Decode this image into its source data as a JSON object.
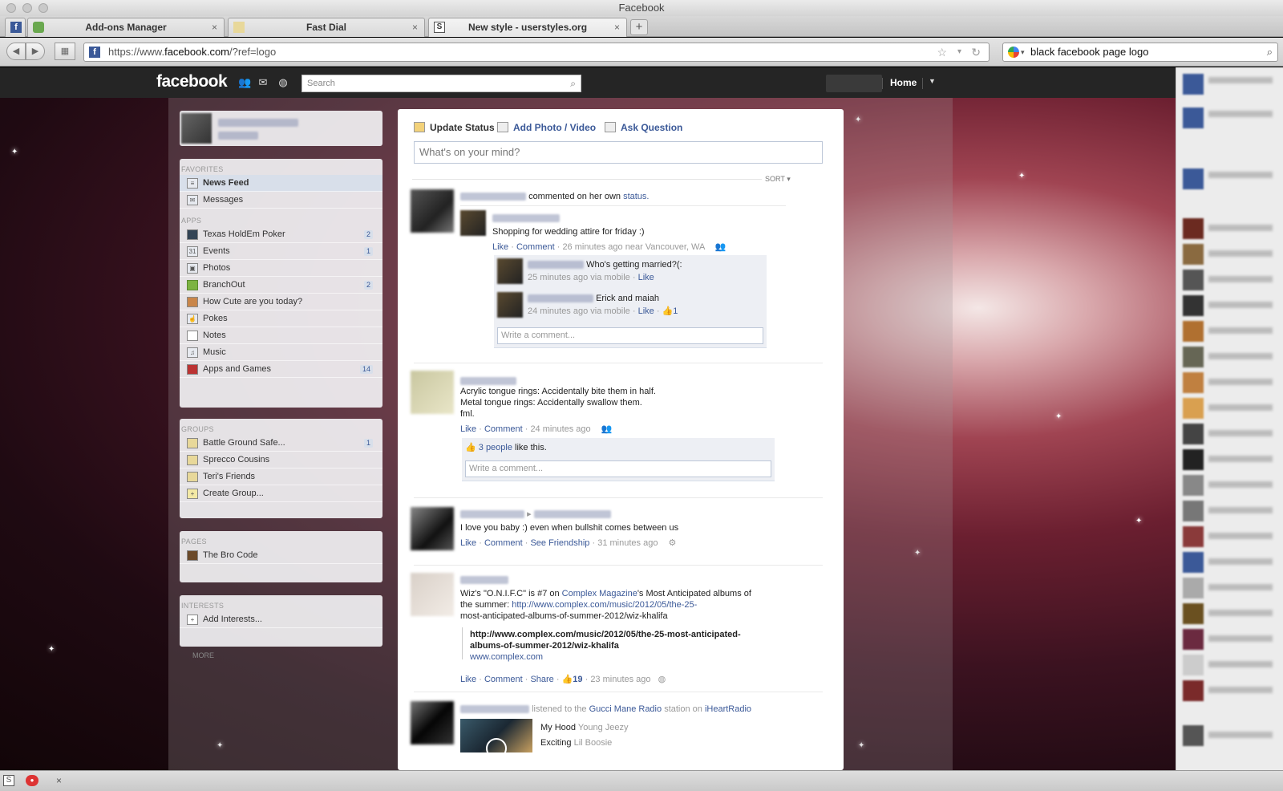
{
  "window": {
    "title": "Facebook"
  },
  "tabs": [
    {
      "label": "Add-ons Manager"
    },
    {
      "label": "Fast Dial"
    },
    {
      "label": "New style - userstyles.org"
    }
  ],
  "browser": {
    "url_scheme": "https://www.",
    "url_host": "facebook.com",
    "url_path": "/?ref=logo",
    "search_value": "black facebook page logo"
  },
  "fb": {
    "logo": "facebook",
    "search_placeholder": "Search",
    "home": "Home"
  },
  "sidebar": {
    "favorites_heading": "FAVORITES",
    "favorites": [
      {
        "label": "News Feed",
        "count": ""
      },
      {
        "label": "Messages",
        "count": ""
      }
    ],
    "apps_heading": "APPS",
    "apps": [
      {
        "label": "Texas HoldEm Poker",
        "count": "2"
      },
      {
        "label": "Events",
        "count": "1"
      },
      {
        "label": "Photos",
        "count": ""
      },
      {
        "label": "BranchOut",
        "count": "2"
      },
      {
        "label": "How Cute are you today?",
        "count": ""
      },
      {
        "label": "Pokes",
        "count": ""
      },
      {
        "label": "Notes",
        "count": ""
      },
      {
        "label": "Music",
        "count": ""
      },
      {
        "label": "Apps and Games",
        "count": "14"
      }
    ],
    "groups_heading": "GROUPS",
    "groups": [
      {
        "label": "Battle Ground Safe...",
        "count": "1"
      },
      {
        "label": "Sprecco Cousins",
        "count": ""
      },
      {
        "label": "Teri's Friends",
        "count": ""
      },
      {
        "label": "Create Group...",
        "count": ""
      }
    ],
    "pages_heading": "PAGES",
    "pages": [
      {
        "label": "The Bro Code",
        "count": ""
      }
    ],
    "interests_heading": "INTERESTS",
    "interests": [
      {
        "label": "Add Interests...",
        "count": ""
      }
    ],
    "more": "MORE"
  },
  "composer": {
    "update_status": "Update Status",
    "add_photo": "Add Photo / Video",
    "ask_question": "Ask Question",
    "placeholder": "What's on your mind?",
    "sort": "SORT"
  },
  "stories": {
    "s1": {
      "action": "commented on her own",
      "action_link": "status.",
      "post": "Shopping for wedding attire for friday :)",
      "actions_like": "Like",
      "actions_comment": "Comment",
      "time": "26 minutes ago near Vancouver, WA",
      "c1_text": "Who's getting married?(:",
      "c1_meta": "25 minutes ago via mobile",
      "c1_like": "Like",
      "c2_text": "Erick and maiah",
      "c2_meta": "24 minutes ago via mobile",
      "c2_like": "Like",
      "c2_likes": "1",
      "write": "Write a comment..."
    },
    "s2": {
      "line1": "Acrylic tongue rings: Accidentally bite them in half.",
      "line2": "Metal tongue rings: Accidentally swallow them.",
      "line3": "fml.",
      "like": "Like",
      "comment": "Comment",
      "time": "24 minutes ago",
      "people": "3 people",
      "like_this": "like this.",
      "write": "Write a comment..."
    },
    "s3": {
      "arrow": "▸",
      "post": "I love you baby :) even when bullshit comes between us",
      "like": "Like",
      "comment": "Comment",
      "friendship": "See Friendship",
      "time": "31 minutes ago"
    },
    "s4": {
      "pre": "Wiz's \"O.N.I.F.C\" is #7 on",
      "mag": "Complex Magazine",
      "post": "'s Most Anticipated albums of",
      "line2_pre": "the summer:",
      "link1": "http://www.complex.com/music/2012/05/the-25-",
      "link2": "most-anticipated-albums-of-summer-2012/wiz-khalifa",
      "att1": "http://www.complex.com/music/2012/05/the-25-most-anticipated-",
      "att2": "albums-of-summer-2012/wiz-khalifa",
      "att_domain": "www.complex.com",
      "like": "Like",
      "comment": "Comment",
      "share": "Share",
      "likes": "19",
      "time": "23 minutes ago"
    },
    "s5": {
      "listened": "listened to the",
      "station": "Gucci Mane Radio",
      "station_on": "station on",
      "service": "iHeartRadio",
      "song1": "My Hood",
      "artist1": "Young Jeezy",
      "song2": "Exciting",
      "artist2": "Lil Boosie"
    }
  },
  "colors": {
    "fb_blue": "#3b5998",
    "bar": "#252525"
  }
}
